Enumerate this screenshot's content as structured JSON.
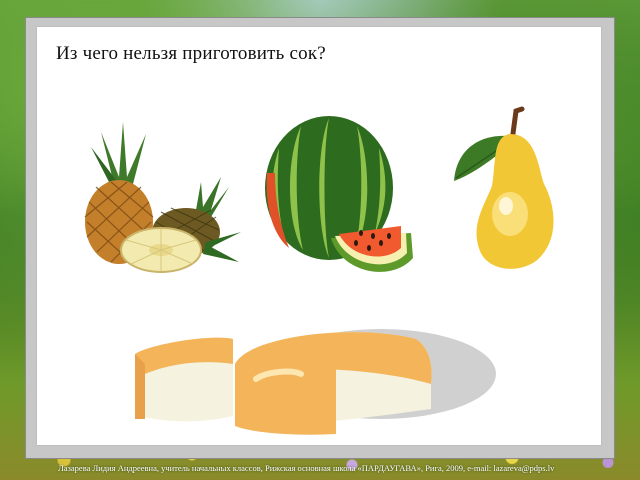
{
  "slide": {
    "question": "Из чего нельзя приготовить сок?",
    "footer": "Лазарева Лидия Андреевна, учитель начальных классов, Рижская основная школа «ПАРДАУГАВА», Рига, 2009, e-mail: lazareva@pdps.lv"
  },
  "images": [
    {
      "name": "pineapple",
      "icon": "pineapple-icon"
    },
    {
      "name": "watermelon",
      "icon": "watermelon-icon"
    },
    {
      "name": "pear",
      "icon": "pear-icon"
    },
    {
      "name": "cheese",
      "icon": "cheese-icon"
    }
  ]
}
